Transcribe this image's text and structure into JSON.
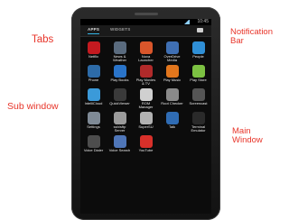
{
  "annotations": {
    "tabs": "Tabs",
    "sub_window": "Sub window",
    "notification_bar": "Notification\nBar",
    "main_window": "Main\nWindow"
  },
  "colors": {
    "annotation": "#e8352a",
    "tab_indicator": "#33b5e5"
  },
  "status_bar": {
    "time": "10:45"
  },
  "tabs": {
    "apps": "APPS",
    "widgets": "WIDGETS",
    "store_icon": "store-icon"
  },
  "apps": [
    {
      "label": "Netflix",
      "icon": "netflix-icon",
      "color": "#c41a20"
    },
    {
      "label": "News &\nWeather",
      "icon": "news-weather-icon",
      "color": "#5a6b7e"
    },
    {
      "label": "Nova\nLauncher",
      "icon": "nova-launcher-icon",
      "color": "#d9562b"
    },
    {
      "label": "OverDrive\nMedia",
      "icon": "overdrive-icon",
      "color": "#3f6fb3"
    },
    {
      "label": "People",
      "icon": "people-icon",
      "color": "#2f8fd6"
    },
    {
      "label": "Phone",
      "icon": "phone-icon",
      "color": "#2d6ba8"
    },
    {
      "label": "Play Books",
      "icon": "play-books-icon",
      "color": "#2a74c9"
    },
    {
      "label": "Play Movies\n& TV",
      "icon": "play-movies-icon",
      "color": "#b12a2a"
    },
    {
      "label": "Play Music",
      "icon": "play-music-icon",
      "color": "#e2761d"
    },
    {
      "label": "Play Store",
      "icon": "play-store-icon",
      "color": "#7cc142"
    },
    {
      "label": "IntelliCloud",
      "icon": "intellicloud-icon",
      "color": "#3b9ad9"
    },
    {
      "label": "QuickViewer",
      "icon": "quickviewer-icon",
      "color": "#3a3a3a"
    },
    {
      "label": "ROM\nManager",
      "icon": "rom-manager-icon",
      "color": "#d0d0d0"
    },
    {
      "label": "Root Checker",
      "icon": "root-checker-icon",
      "color": "#8a8a8a"
    },
    {
      "label": "Screencast",
      "icon": "screencast-icon",
      "color": "#555555"
    },
    {
      "label": "Settings",
      "icon": "settings-icon",
      "color": "#7f8a96"
    },
    {
      "label": "ssh/sftp\nServer",
      "icon": "ssh-server-icon",
      "color": "#9b9b9b"
    },
    {
      "label": "SuperSU",
      "icon": "supersu-icon",
      "color": "#b2b2b2"
    },
    {
      "label": "Talk",
      "icon": "talk-icon",
      "color": "#2f6cb4"
    },
    {
      "label": "Terminal\nEmulator",
      "icon": "terminal-icon",
      "color": "#2a2a2a"
    },
    {
      "label": "Voice Dialer",
      "icon": "voice-dialer-icon",
      "color": "#4d4d4d"
    },
    {
      "label": "Voice Search",
      "icon": "voice-search-icon",
      "color": "#4f76b8"
    },
    {
      "label": "YouTube",
      "icon": "youtube-icon",
      "color": "#d8302a"
    }
  ]
}
